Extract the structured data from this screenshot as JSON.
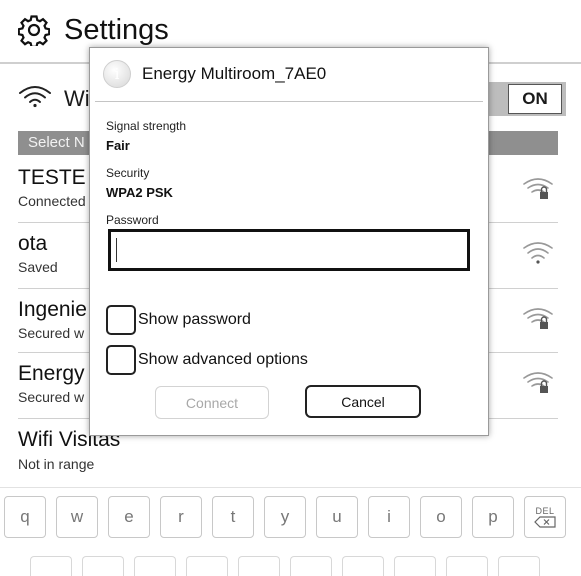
{
  "header": {
    "title": "Settings",
    "icon": "gear-icon"
  },
  "wifi_toggle": {
    "label": "Wi",
    "state": "ON"
  },
  "section": {
    "label": "Select N"
  },
  "networks": [
    {
      "name": "TESTE",
      "status": "Connected",
      "signal_icon": "wifi-lock-icon"
    },
    {
      "name": "ota",
      "status": "Saved",
      "signal_icon": "wifi-icon"
    },
    {
      "name": "Ingenie",
      "status": "Secured w",
      "signal_icon": "wifi-lock-icon"
    },
    {
      "name": "Energy",
      "status": "Secured w",
      "signal_icon": "wifi-lock-icon"
    },
    {
      "name": "Wifi Visitas",
      "status": "Not in range"
    }
  ],
  "dialog": {
    "title": "Energy Multiroom_7AE0",
    "signal_label": "Signal strength",
    "signal_value": "Fair",
    "security_label": "Security",
    "security_value": "WPA2 PSK",
    "password_label": "Password",
    "password_value": "",
    "show_password_label": "Show password",
    "show_password_checked": false,
    "advanced_label": "Show advanced options",
    "advanced_checked": false,
    "connect_label": "Connect",
    "connect_enabled": false,
    "cancel_label": "Cancel"
  },
  "keyboard": {
    "row1": [
      "q",
      "w",
      "e",
      "r",
      "t",
      "y",
      "u",
      "i",
      "o",
      "p"
    ],
    "del_label": "DEL"
  }
}
